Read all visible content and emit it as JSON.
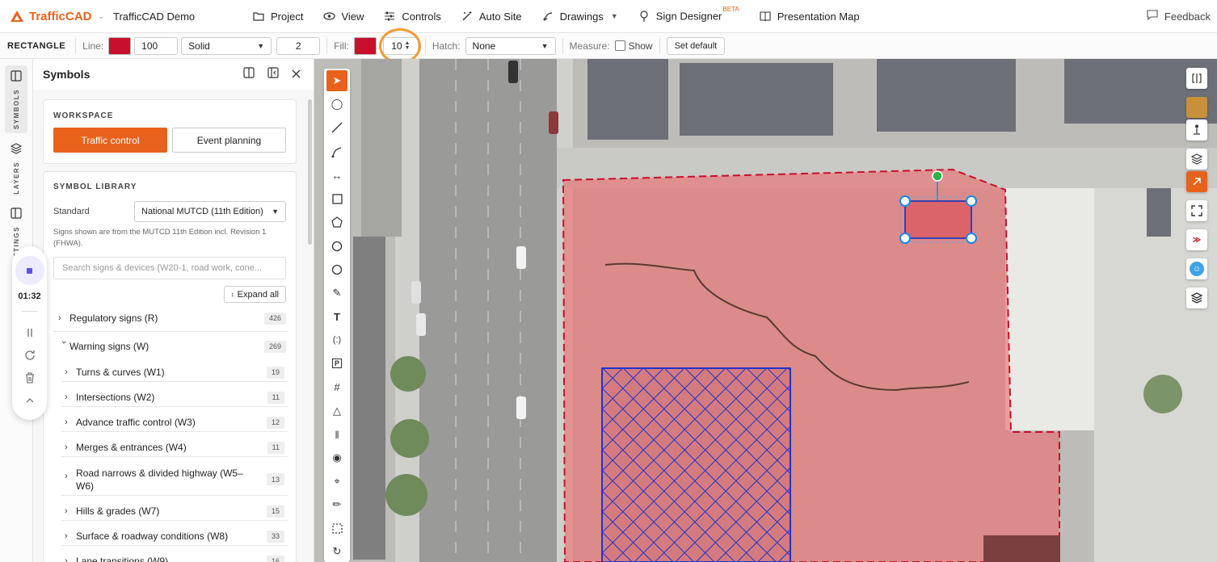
{
  "app": {
    "brand": "TrafficCAD",
    "project_name": "TrafficCAD Demo",
    "colors": {
      "accent": "#e8621c",
      "line_color": "#c8102e",
      "fill_color": "#c8102e",
      "selection": "#1e88e5"
    }
  },
  "nav": {
    "items": [
      {
        "label": "Project",
        "icon": "folder-icon"
      },
      {
        "label": "View",
        "icon": "eye-icon"
      },
      {
        "label": "Controls",
        "icon": "sliders-icon"
      },
      {
        "label": "Auto Site",
        "icon": "magic-wand-icon"
      },
      {
        "label": "Drawings",
        "icon": "drawings-icon"
      },
      {
        "label": "Sign Designer",
        "icon": "sign-icon",
        "badge": "BETA"
      },
      {
        "label": "Presentation Map",
        "icon": "book-map-icon"
      }
    ],
    "feedback": "Feedback"
  },
  "props": {
    "shape": "RECTANGLE",
    "line_label": "Line:",
    "line_width": "100",
    "line_style": "Solid",
    "line_value": "2",
    "fill_label": "Fill:",
    "fill_value": "10",
    "hatch_label": "Hatch:",
    "hatch_value": "None",
    "measure_label": "Measure:",
    "show_label": "Show",
    "set_default": "Set default"
  },
  "rail": {
    "symbols": "SYMBOLS",
    "layers": "LAYERS",
    "settings": "SETTINGS",
    "timer": "01:32"
  },
  "panel": {
    "title": "Symbols",
    "workspace_title": "WORKSPACE",
    "workspace_on": "Traffic control",
    "workspace_off": "Event planning",
    "library_title": "SYMBOL LIBRARY",
    "standard_label": "Standard",
    "standard_value": "National MUTCD (11th Edition)",
    "note": "Signs shown are from the MUTCD 11th Edition incl. Revision 1 (FHWA).",
    "search_placeholder": "Search signs & devices (W20-1, road work, cone...",
    "expand_all": "Expand all",
    "categories": [
      {
        "label": "Regulatory signs (R)",
        "count": "426"
      },
      {
        "label": "Warning signs (W)",
        "count": "269"
      }
    ],
    "subcategories": [
      {
        "label": "Turns & curves (W1)",
        "count": "19"
      },
      {
        "label": "Intersections (W2)",
        "count": "11"
      },
      {
        "label": "Advance traffic control (W3)",
        "count": "12"
      },
      {
        "label": "Merges & entrances (W4)",
        "count": "11"
      },
      {
        "label": "Road narrows & divided highway (W5–W6)",
        "count": "13"
      },
      {
        "label": "Hills & grades (W7)",
        "count": "15"
      },
      {
        "label": "Surface & roadway conditions (W8)",
        "count": "33"
      },
      {
        "label": "Lane transitions (W9)",
        "count": "16"
      }
    ]
  }
}
